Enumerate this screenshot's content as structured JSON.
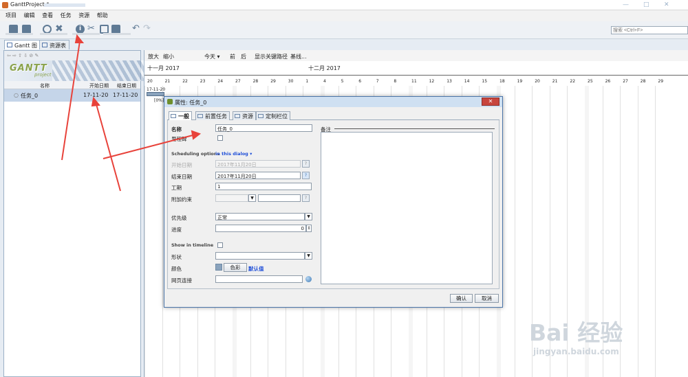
{
  "window": {
    "title": "GanttProject *",
    "controls": [
      "—",
      "□",
      "✕"
    ]
  },
  "menu": [
    "项目",
    "编辑",
    "查看",
    "任务",
    "资源",
    "帮助"
  ],
  "search": {
    "placeholder": "搜索 <Ctrl+F>"
  },
  "tabs": [
    "Gantt 图",
    "资源表"
  ],
  "task_table": {
    "headers": [
      "名称",
      "开始日期",
      "结束日期"
    ],
    "rows": [
      {
        "name": "任务_0",
        "start": "17-11-20",
        "end": "17-11-20"
      }
    ]
  },
  "chart_toolbar": [
    "放大",
    "缩小",
    "今天 ▾",
    "前",
    "后",
    "显示关键路径",
    "基线..."
  ],
  "timeline": {
    "months": [
      "十一月 2017",
      "十二月 2017"
    ],
    "days": [
      "20",
      "21",
      "22",
      "23",
      "24",
      "27",
      "28",
      "29",
      "30",
      "1",
      "4",
      "5",
      "6",
      "7",
      "8",
      "11",
      "12",
      "13",
      "14",
      "15",
      "18",
      "19",
      "20",
      "21",
      "22",
      "25",
      "26",
      "27",
      "28",
      "29"
    ],
    "bar_label": "17-11-20",
    "progress_label": "[0%]"
  },
  "dialog": {
    "title": "属性: 任务_0",
    "close": "✕",
    "tabs": [
      "一般",
      "前置任务",
      "资源",
      "定制栏位"
    ],
    "fields": {
      "name_label": "名称",
      "name_value": "任务_0",
      "milestone_label": "里程碑",
      "sched_label": "Scheduling options",
      "sched_value": "in this dialog ▾",
      "start_label": "开始日期",
      "start_value": "2017年11月20日",
      "end_label": "结束日期",
      "end_value": "2017年11月20日",
      "duration_label": "工期",
      "duration_value": "1",
      "constraint_label": "附加约束",
      "priority_label": "优先级",
      "priority_value": "正常",
      "progress_label": "进度",
      "progress_value": "0",
      "timeline_label": "Show in timeline",
      "shape_label": "形状",
      "color_label": "颜色",
      "color_button": "色彩",
      "color_default": "默认值",
      "web_label": "网页连接",
      "notes_label": "备注"
    },
    "ok": "确认",
    "cancel": "取消"
  },
  "watermark": {
    "brand": "Bai 经验",
    "url": "jingyan.baidu.com"
  },
  "colors": {
    "arrow": "#e8423a",
    "selected_row": "#c5d5e9",
    "dialog_border": "#4a74a8",
    "close_button": "#c8453d"
  }
}
